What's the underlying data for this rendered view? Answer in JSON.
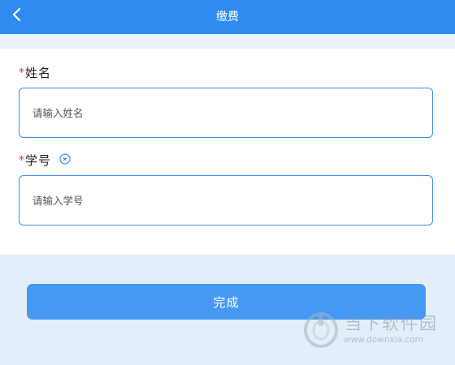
{
  "header": {
    "title": "缴费",
    "back_icon": "chevron-left-icon"
  },
  "form": {
    "name_field": {
      "required_mark": "*",
      "label": "姓名",
      "placeholder": "请输入姓名",
      "value": ""
    },
    "student_id_field": {
      "required_mark": "*",
      "label": "学号",
      "dropdown_icon": "chevron-down-circle-icon",
      "placeholder": "请输入学号",
      "value": ""
    }
  },
  "submit": {
    "label": "完成"
  },
  "watermark": {
    "name": "当下软件园",
    "url": "www.downxia.com"
  },
  "colors": {
    "header_bg": "#2e8cf0",
    "page_bg": "#e4eefa",
    "input_border": "#3a8ee6",
    "button_bg": "#4499f2",
    "required": "#e03b3b"
  }
}
